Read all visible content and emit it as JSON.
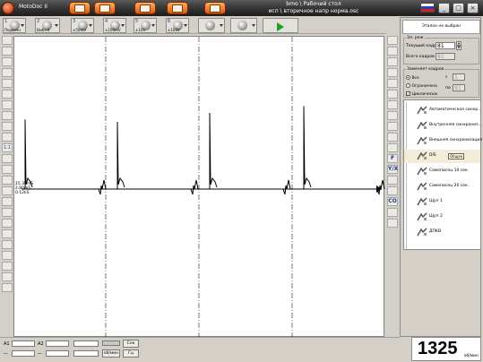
{
  "app": {
    "title": "MotoDoc II"
  },
  "window": {
    "path_line1": "bmo \\ Рабочий стол",
    "path_line2": "исп \\ вторичное напр норма.osc"
  },
  "title_buttons": [
    "video-icon",
    "eraser-icon",
    "person-icon",
    "clipboard-icon",
    "wrench-icon"
  ],
  "toolbar": {
    "tools": [
      {
        "num": "1",
        "label": "Первичн"
      },
      {
        "num": "2",
        "label": "Вмбл II"
      },
      {
        "num": "3",
        "label": "±50mV"
      },
      {
        "num": "4",
        "label": "±100mV"
      },
      {
        "num": "5",
        "label": "±10V"
      },
      {
        "num": "6",
        "label": "±100V"
      },
      {
        "num": "",
        "label": ""
      },
      {
        "num": "",
        "label": ""
      }
    ],
    "play_icon": "play-icon"
  },
  "left_strip": {
    "buttons": [
      "",
      "",
      "",
      "",
      "",
      "",
      "",
      "",
      "",
      "",
      "1:1",
      "",
      "",
      "",
      "",
      "",
      "",
      "",
      "",
      "",
      "",
      "",
      "",
      ""
    ]
  },
  "scale": {
    "line1": "15.36mS",
    "line2": "2.80mS",
    "line3": "0.12kS"
  },
  "right_col": {
    "buttons": [
      "",
      "",
      "",
      "",
      "",
      "",
      "",
      "",
      "",
      "",
      "",
      "F",
      "Y/X",
      "",
      "",
      "CO",
      "",
      ""
    ]
  },
  "panel": {
    "etalon": "Эталон не выбран",
    "frames_title": "Эл. реж",
    "current_frame_label": "Текущий кадр",
    "current_frame_value": "81",
    "total_frames_label": "Всего кадров",
    "total_frames_value": "81",
    "display_title": "Заменяет кадров",
    "opt_all": "Все",
    "opt_limited": "Ограничено",
    "opt_cyclic": "Циклически",
    "from_label": "с",
    "from_value": "1",
    "to_label": "по",
    "to_value": "81",
    "filters": [
      {
        "label": "Автоматическая синхр...",
        "icon": "auto-sync-icon"
      },
      {
        "label": "Внутренняя синхрониз...",
        "icon": "internal-sync-icon"
      },
      {
        "label": "Внешняя синхронизация",
        "icon": "external-sync-icon"
      },
      {
        "label": "DIS",
        "icon": "dis-icon"
      },
      {
        "label": "Самописец 10 сек.",
        "icon": "recorder-10-icon"
      },
      {
        "label": "Самописец 20 сек.",
        "icon": "recorder-20-icon"
      },
      {
        "label": "Щуп 1",
        "icon": "probe-1-icon"
      },
      {
        "label": "Щуп 2",
        "icon": "probe-2-icon"
      },
      {
        "label": "ДПКВ",
        "icon": "crank-sensor-icon"
      }
    ],
    "tooltip": "Общее"
  },
  "bottom": {
    "a1_label": "A1",
    "a2_label": "A2",
    "sec_button": "Сек",
    "rpm_button": "об/мин",
    "hz_button": "Гц"
  },
  "counter": {
    "value": "1325",
    "unit": "об/мин"
  }
}
